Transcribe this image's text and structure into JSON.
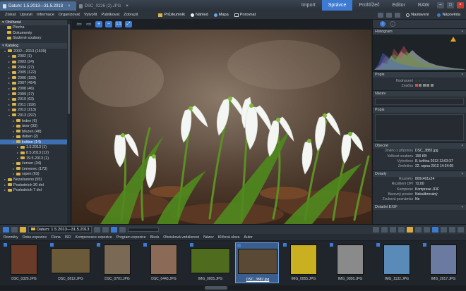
{
  "titlebar": {
    "tabs": [
      {
        "label": "Datum: 1.5.2013—31.5.2013",
        "active": true
      },
      {
        "label": "DSC_0226 (2).JPG",
        "active": false
      }
    ],
    "close_glyph": "×",
    "modes": [
      "Import",
      "Správce",
      "Prohlížeč",
      "Editor",
      "RAW"
    ],
    "active_mode": "Správce",
    "window_buttons": [
      "–",
      "□",
      "×"
    ]
  },
  "menubar": {
    "items": [
      "Získat",
      "Upravit",
      "Informace",
      "Organizovat",
      "Vytvořit",
      "Publikovat",
      "Zobrazit"
    ],
    "views": [
      {
        "label": "Průzkumník",
        "icon": "folder-icon"
      },
      {
        "label": "Náhled",
        "icon": "eye-icon"
      },
      {
        "label": "Mapa",
        "icon": "globe-icon"
      },
      {
        "label": "Porovnat",
        "icon": "compare-icon"
      }
    ],
    "settings_label": "Nastavení",
    "help_label": "Nápověda"
  },
  "tree": {
    "favorites_header": "Oblíbené",
    "favorites": [
      "Plocha",
      "Dokumenty",
      "Stažené soubory"
    ],
    "catalog_header": "Katalog",
    "rows": [
      {
        "label": "2002—2013 (1639)",
        "indent": 1,
        "open": true
      },
      {
        "label": "2002 (1)",
        "indent": 2
      },
      {
        "label": "2003 (24)",
        "indent": 2
      },
      {
        "label": "2004 (27)",
        "indent": 2
      },
      {
        "label": "2005 (122)",
        "indent": 2
      },
      {
        "label": "2006 (183)",
        "indent": 2
      },
      {
        "label": "2007 (454)",
        "indent": 2
      },
      {
        "label": "2008 (46)",
        "indent": 2
      },
      {
        "label": "2009 (17)",
        "indent": 2
      },
      {
        "label": "2010 (63)",
        "indent": 2
      },
      {
        "label": "2011 (192)",
        "indent": 2
      },
      {
        "label": "2012 (213)",
        "indent": 2
      },
      {
        "label": "2013 (297)",
        "indent": 2,
        "open": true
      },
      {
        "label": "leden (6)",
        "indent": 3
      },
      {
        "label": "únor (33)",
        "indent": 3
      },
      {
        "label": "březen (48)",
        "indent": 3
      },
      {
        "label": "duben (2)",
        "indent": 3
      },
      {
        "label": "květen (14)",
        "indent": 3,
        "open": true,
        "selected": true
      },
      {
        "label": "1.5.2013 (1)",
        "indent": 4
      },
      {
        "label": "8.5.2013 (12)",
        "indent": 4
      },
      {
        "label": "19.5.2013 (1)",
        "indent": 4
      },
      {
        "label": "červen (34)",
        "indent": 3
      },
      {
        "label": "červenec (173)",
        "indent": 3
      },
      {
        "label": "srpen (63)",
        "indent": 3
      },
      {
        "label": "Nezařazeno (55)",
        "indent": 1
      },
      {
        "label": "Posledních 30 dní",
        "indent": 1
      },
      {
        "label": "Posledních 7 dní",
        "indent": 1
      }
    ]
  },
  "right_panel": {
    "sections": {
      "histogram": "Histogram",
      "popis": "Popis",
      "nazev": "Název",
      "popis2": "Popis",
      "obecne": "Obecné",
      "detaily": "Detaily",
      "exif": "Detailní EXIF"
    },
    "rating_label": "Hodnocení",
    "tag_label": "Značka",
    "general": [
      {
        "k": "Jméno s příponou",
        "v": "DSC_3882.jpg"
      },
      {
        "k": "Velikost souboru",
        "v": "190 KB"
      },
      {
        "k": "Vytvořeno",
        "v": "8. května 2013 13:03:37"
      },
      {
        "k": "Změněno",
        "v": "22. srpna 2013 14:24:05"
      }
    ],
    "details": [
      {
        "k": "Rozměry",
        "v": "800x401x24"
      },
      {
        "k": "Rozlišení DPI",
        "v": "72,00"
      },
      {
        "k": "Komprese",
        "v": "Komprese JFIF"
      },
      {
        "k": "Barevný prostor",
        "v": "Nekalibrováný"
      },
      {
        "k": "Zvuková poznámka",
        "v": "Ne"
      }
    ]
  },
  "bottom": {
    "path": "Datum: 1.5.2013—31.5.2013"
  },
  "sortbar": {
    "items": [
      "Rozměry",
      "Doba expozice",
      "Clona",
      "ISO",
      "Kompenzace expozice",
      "Program expozice",
      "Blesk",
      "Ohnisková vzdálenost",
      "Název",
      "Klíčová slova",
      "Autor"
    ]
  },
  "filmstrip": {
    "items": [
      {
        "caption": "DSC_0326.JPG",
        "landscape": false,
        "color": "#6b3b2a",
        "selected": false
      },
      {
        "caption": "DSC_0812.JPG",
        "landscape": true,
        "color": "#6a5a3a",
        "selected": false
      },
      {
        "caption": "DSC_0701.JPG",
        "landscape": false,
        "color": "#7a6a55",
        "selected": false
      },
      {
        "caption": "DSC_0443.JPG",
        "landscape": false,
        "color": "#8b6b58",
        "selected": false
      },
      {
        "caption": "IMG_0005.JPG",
        "landscape": true,
        "color": "#4f6b1e",
        "selected": false
      },
      {
        "caption": "DSC_3882.jpg",
        "landscape": true,
        "color": "#5a4a35",
        "selected": true
      },
      {
        "caption": "IMG_0055.JPG",
        "landscape": false,
        "color": "#c8b020",
        "selected": false
      },
      {
        "caption": "IMG_0056.JPG",
        "landscape": false,
        "color": "#8a8a8a",
        "selected": false
      },
      {
        "caption": "IMG_1132.JPG",
        "landscape": false,
        "color": "#5a8ab8",
        "selected": false
      },
      {
        "caption": "IMG_2017.JPG",
        "landscape": false,
        "color": "#6a7aa0",
        "selected": false
      }
    ]
  }
}
